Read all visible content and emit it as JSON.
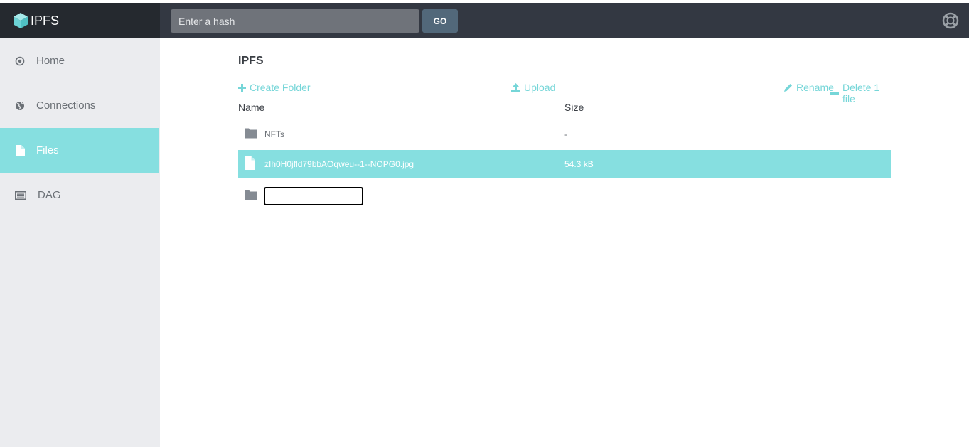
{
  "app": {
    "brand": "IPFS"
  },
  "search": {
    "placeholder": "Enter a hash",
    "go_label": "GO"
  },
  "sidebar": {
    "items": [
      {
        "label": "Home",
        "icon": "target-icon",
        "active": false
      },
      {
        "label": "Connections",
        "icon": "globe-icon",
        "active": false
      },
      {
        "label": "Files",
        "icon": "file-icon",
        "active": true
      },
      {
        "label": "DAG",
        "icon": "list-icon",
        "active": false
      }
    ]
  },
  "files": {
    "title": "IPFS",
    "actions": {
      "create_folder": "Create Folder",
      "upload": "Upload",
      "rename": "Rename",
      "delete": "Delete 1 file"
    },
    "columns": {
      "name": "Name",
      "size": "Size"
    },
    "rows": [
      {
        "name": "NFTs",
        "size": "-",
        "type": "folder",
        "selected": false
      },
      {
        "name": "zIh0H0jfld79bbAOqweu--1--NOPG0.jpg",
        "size": "54.3 kB",
        "type": "file",
        "selected": true
      },
      {
        "name": "",
        "size": "",
        "type": "folder",
        "editing": true
      }
    ]
  },
  "colors": {
    "accent": "#86dfe0",
    "topbar": "#333842",
    "sidebar": "#ebecef",
    "link": "#76d6d8"
  }
}
